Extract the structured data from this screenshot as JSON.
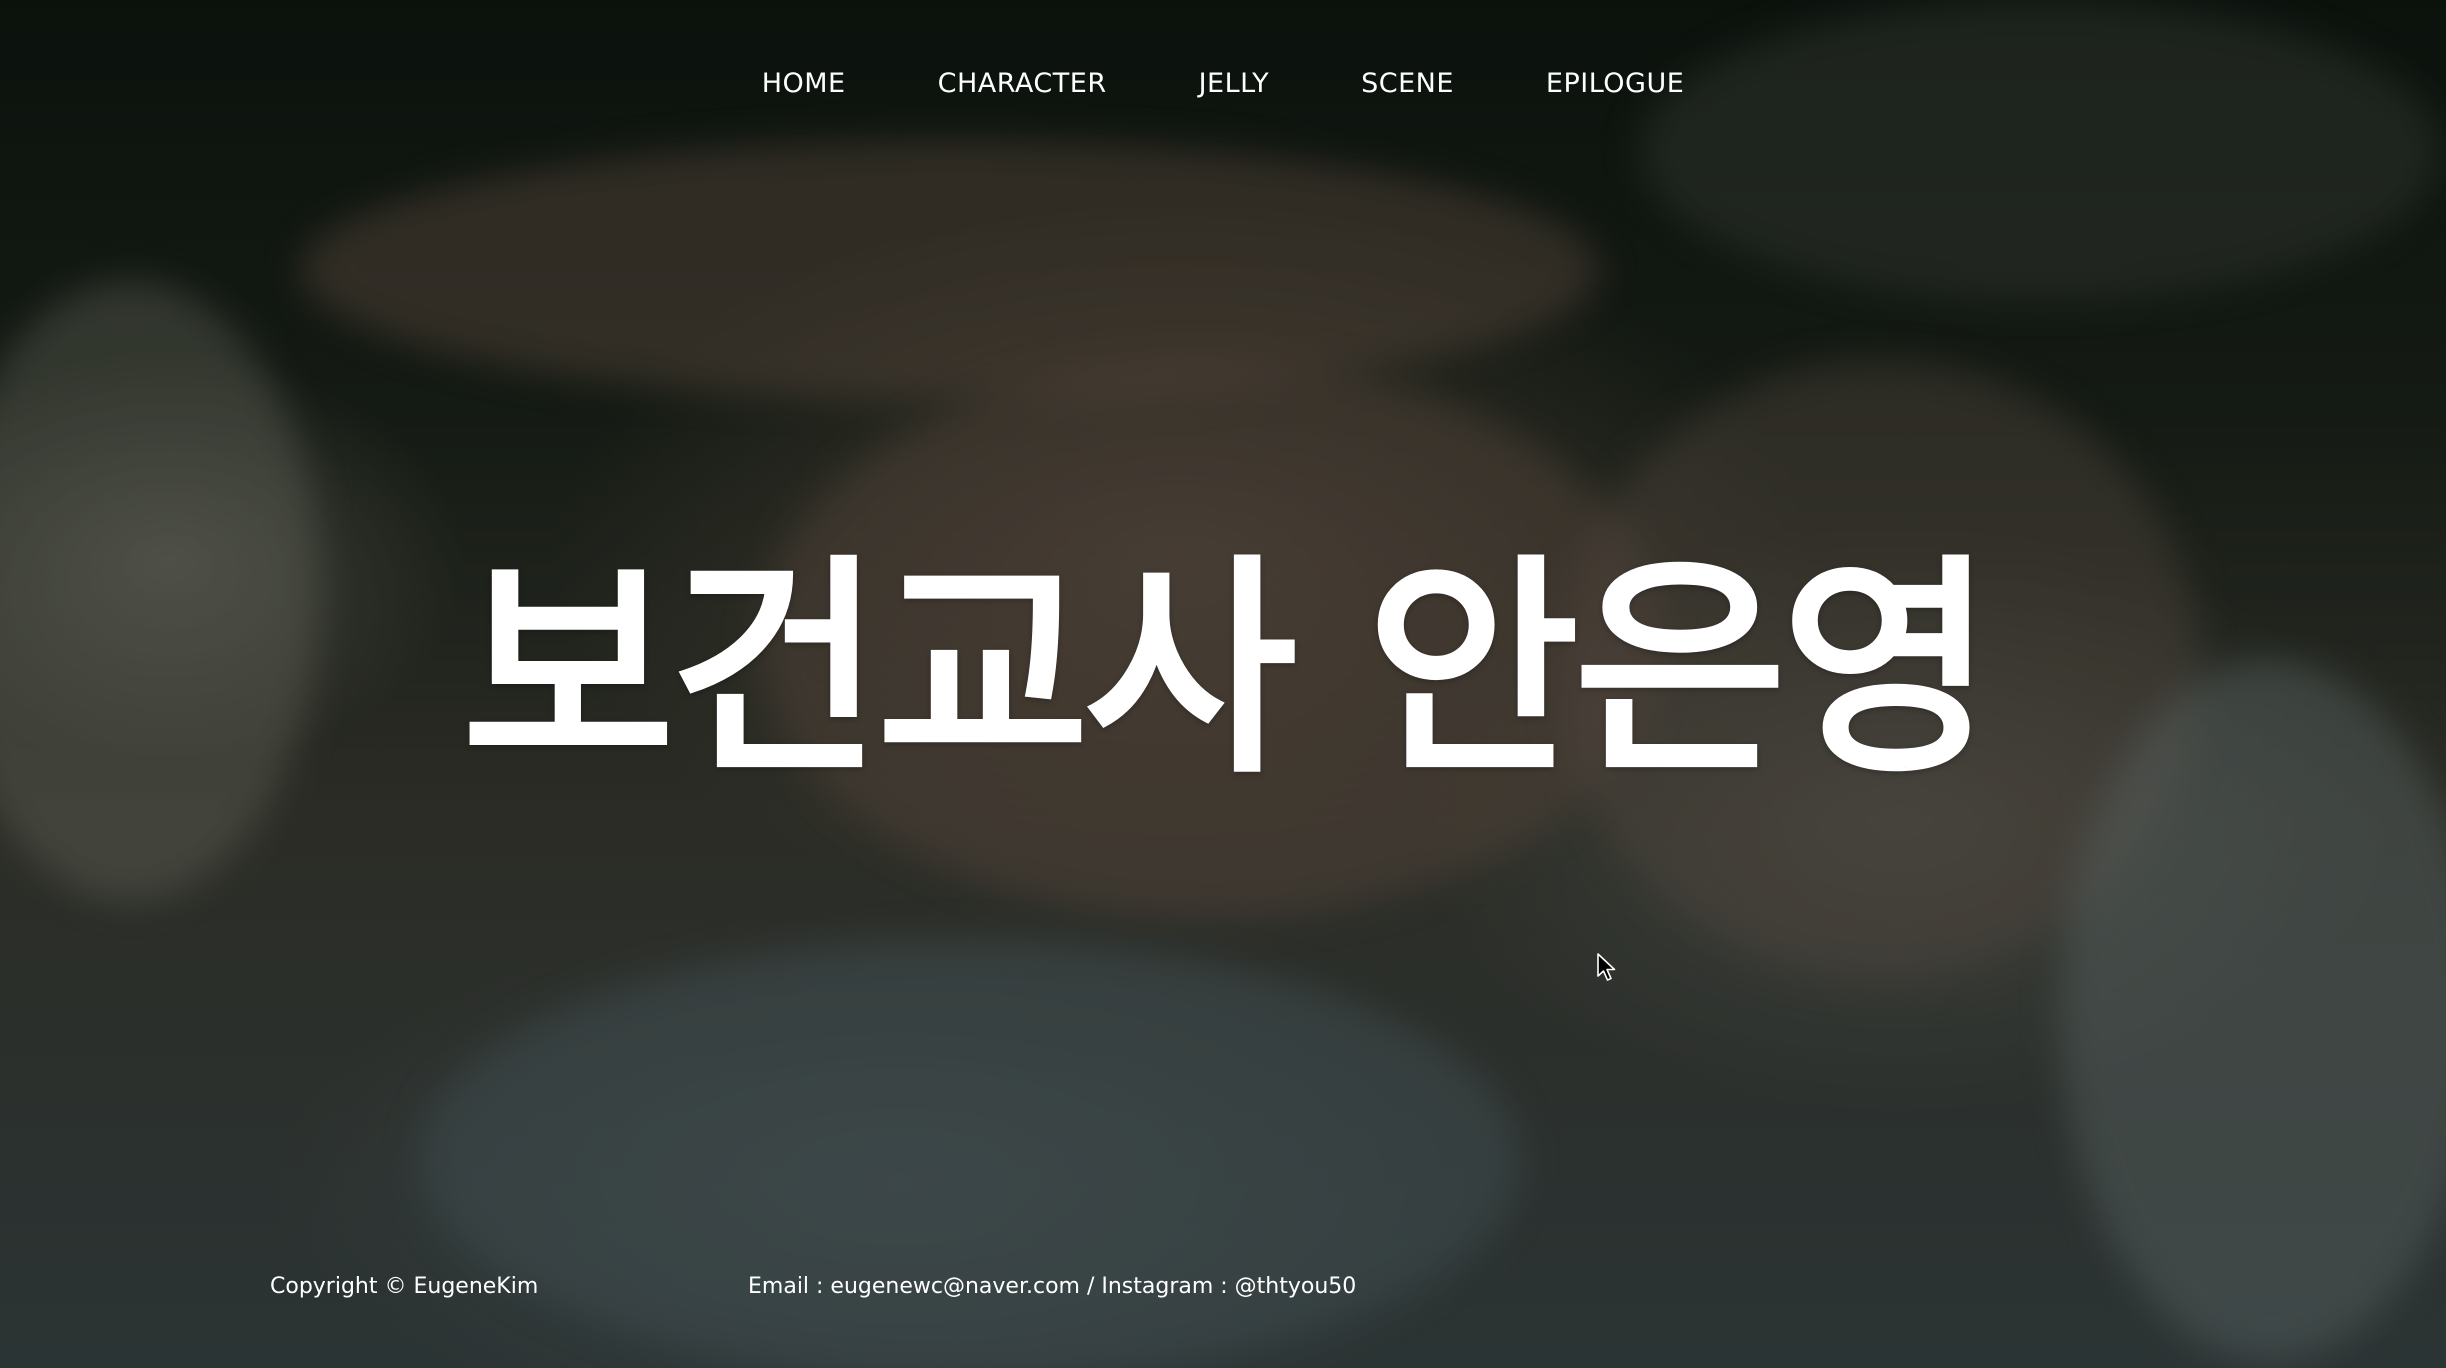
{
  "nav": {
    "items": [
      {
        "label": "HOME"
      },
      {
        "label": "CHARACTER"
      },
      {
        "label": "JELLY"
      },
      {
        "label": "SCENE"
      },
      {
        "label": "EPILOGUE"
      }
    ]
  },
  "hero": {
    "title": "보건교사 안은영"
  },
  "footer": {
    "copyright": "Copyright © EugeneKim",
    "contact": "Email : eugenewc@naver.com / Instagram : @thtyou50"
  },
  "icons": {
    "cursor": "mouse-pointer-icon"
  }
}
